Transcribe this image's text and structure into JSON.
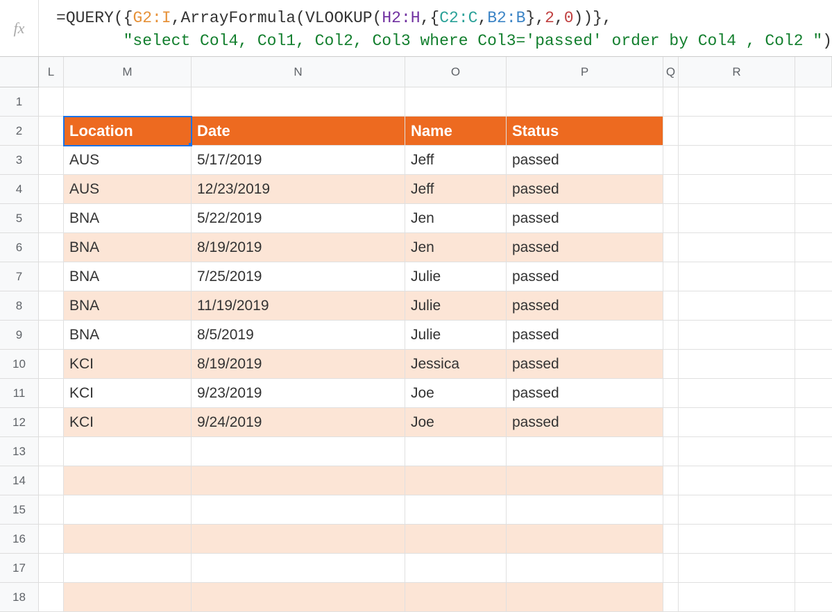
{
  "fx": {
    "label": "fx",
    "eq": "=",
    "query": "QUERY",
    "lb1": "(",
    "lc1": "{",
    "r1": "G2:I",
    "c1": ",",
    "arr": "ArrayFormula",
    "lb2": "(",
    "vl": "VLOOKUP",
    "lb3": "(",
    "r2": "H2:H",
    "c2": ",",
    "lc2": "{",
    "r3": "C2:C",
    "c3": ",",
    "r4": "B2:B",
    "rc2": "}",
    "c4": ",",
    "n2": "2",
    "c5": ",",
    "n0": "0",
    "rb3": ")",
    "rb2": ")",
    "rc1": "}",
    "c6": ",",
    "qstr": "\"select Col4, Col1, Col2, Col3 where Col3='passed' order by Col4 , Col2 \"",
    "rb1": ")"
  },
  "cols": [
    "",
    "L",
    "M",
    "N",
    "O",
    "P",
    "Q",
    "R",
    ""
  ],
  "rowNums": [
    "1",
    "2",
    "3",
    "4",
    "5",
    "6",
    "7",
    "8",
    "9",
    "10",
    "11",
    "12",
    "13",
    "14",
    "15",
    "16",
    "17",
    "18"
  ],
  "headers": [
    "Location",
    "Date",
    "Name",
    "Status"
  ],
  "rows": [
    {
      "loc": "AUS",
      "date": "5/17/2019",
      "name": "Jeff",
      "status": "passed"
    },
    {
      "loc": "AUS",
      "date": "12/23/2019",
      "name": "Jeff",
      "status": "passed"
    },
    {
      "loc": "BNA",
      "date": "5/22/2019",
      "name": "Jen",
      "status": "passed"
    },
    {
      "loc": "BNA",
      "date": "8/19/2019",
      "name": "Jen",
      "status": "passed"
    },
    {
      "loc": "BNA",
      "date": "7/25/2019",
      "name": "Julie",
      "status": "passed"
    },
    {
      "loc": "BNA",
      "date": "11/19/2019",
      "name": "Julie",
      "status": "passed"
    },
    {
      "loc": "BNA",
      "date": "8/5/2019",
      "name": "Julie",
      "status": "passed"
    },
    {
      "loc": "KCI",
      "date": "8/19/2019",
      "name": "Jessica",
      "status": "passed"
    },
    {
      "loc": "KCI",
      "date": "9/23/2019",
      "name": "Joe",
      "status": "passed"
    },
    {
      "loc": "KCI",
      "date": "9/24/2019",
      "name": "Joe",
      "status": "passed"
    }
  ]
}
